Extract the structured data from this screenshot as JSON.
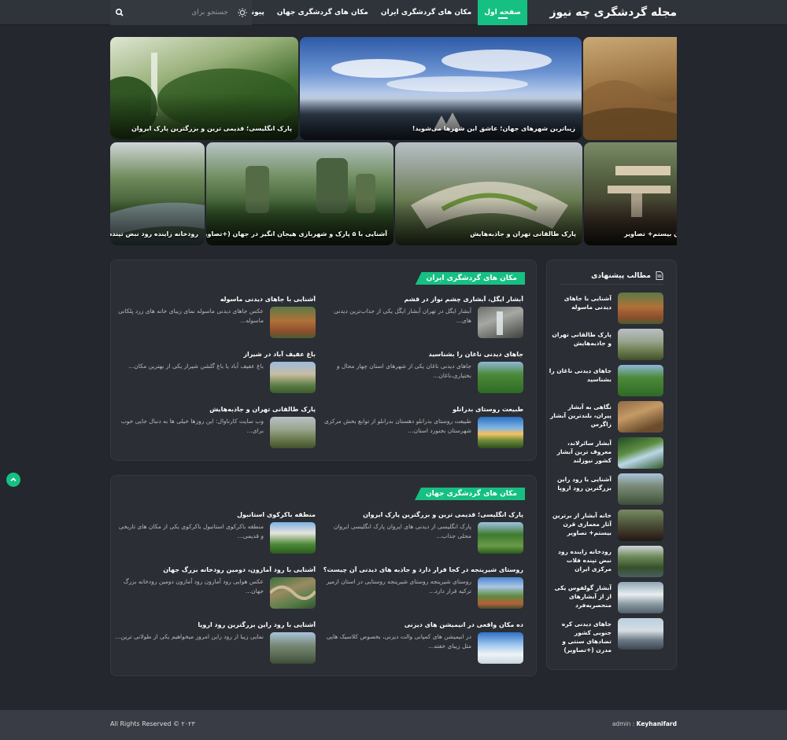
{
  "header": {
    "site_title": "مجله گردشگری چه نیوز",
    "nav": [
      {
        "label": "صفحه اول",
        "active": true
      },
      {
        "label": "مکان های گردشگری ایران"
      },
      {
        "label": "مکان های گردشگری جهان"
      },
      {
        "label": "پیوندها"
      }
    ],
    "search_placeholder": "جستجو برای",
    "search_icon": "search-icon",
    "theme_icon": "sun-icon"
  },
  "slider": {
    "slides": [
      {
        "caption": "پارک انگلیسی؛ قدیمی ترین و بزرگترین پارک ایروان"
      },
      {
        "caption": "زیباترین شهرهای جهان؛ عاشق این شهرها می‌شوید!"
      },
      {
        "caption": ""
      },
      {
        "caption": "رودخانه زاینده رود نبض تپنده فلا"
      },
      {
        "caption": "آشنایی با ۵ پارک و شهربازی هیجان انگیز در جهان (+تصاویر)"
      },
      {
        "caption": "پارک طالقانی تهران و جاذبه‌هایش"
      },
      {
        "caption": "ن بیستم+ تصاویر"
      }
    ]
  },
  "iran_section": {
    "title": "مکان های گردشگری ایران",
    "posts": [
      {
        "title": "آبشار ایگل، آبشاری چشم نواز در قشم",
        "excerpt": "آبشار ایگل در تهران   آبشار ایگَل یکی از جذاب‌ترین دیدنی های..."
      },
      {
        "title": "آشنایی با جاهای دیدنی ماسوله",
        "excerpt": "عکس جاهای دیدنی ماسوله   نمای زیبای خانه های زرد پلکانی ماسوله..."
      },
      {
        "title": "جاهای دیدنی ناغان را بشناسید",
        "excerpt": "جاهای دیدنی ناغان   یکی از شهرهای استان چهار محال و بختیاری،ناغان..."
      },
      {
        "title": "باغ عفیف آباد در شیراز",
        "excerpt": "باغ عفیف آباد یا باغ گلشن   شیراز یکی از بهترین مکان..."
      },
      {
        "title": "طبیعت روستای بدرانلو",
        "excerpt": "طبیعت روستای بدرانلو دهستان بدرانلو از توابع بخش مرکزی شهرستان بجنورد استان..."
      },
      {
        "title": "پارک طالقانی تهران و جاذبه‌هایش",
        "excerpt": "وب سایت کارناوال: این روزها خیلی ها به دنبال جایی خوب برای..."
      }
    ]
  },
  "world_section": {
    "title": "مکان های گردشگری جهان",
    "posts": [
      {
        "title": "پارک انگلیسی؛ قدیمی ترین و بزرگترین پارک ایروان",
        "excerpt": "پارک انگلیسی از دیدنی های ایروان   پارک انگلیسی ایروان محلی جذاب..."
      },
      {
        "title": "منطقه باکرکوی استانبول",
        "excerpt": "منطقه باکرکوی استانبول   باکرکوی یکی از مکان های تاریخی و قدیمی..."
      },
      {
        "title": "روستای شیرینجه در کجا قرار دارد و جاذبه های دیدنی آن چیست؟",
        "excerpt": "روستای شیرینجه   روستای شیرینجه روستایی در استان ازمیر ترکیه قرار دارد..."
      },
      {
        "title": "آشنایی با رود آمازون، دومین رودخانه بزرگ جهان",
        "excerpt": "عکس هوایی رود آمازون   رود آمازون دومین رودخانه بزرگ جهان..."
      },
      {
        "title": "ده مکان واقعی در انیمیشن های دیزنی",
        "excerpt": "در انیمیشن های کمپانی والت دیزنی، بخصوص کلاسیک هایی مثل زیبای خفته..."
      },
      {
        "title": "آشنایی با رود راین بزرگترین رود اروپا",
        "excerpt": "نمایی زیبا از رود راین   امروز میخواهیم یکی از طولانی ترین..."
      }
    ]
  },
  "sidebar": {
    "title": "مطالب پیشنهادی",
    "icon": "document-icon",
    "items": [
      {
        "title": "آشنایی با جاهای دیدنی ماسوله"
      },
      {
        "title": "پارک طالقانی تهران و جاذبه‌هایش"
      },
      {
        "title": "جاهای دیدنی ناغان را بشناسید"
      },
      {
        "title": "نگاهی به آبشار پیران، بلندترین آبشار زاگرس"
      },
      {
        "title": "آبشار سائرلاند، معروف ترین آبشار کشور نیوزلند"
      },
      {
        "title": "آشنایی با رود راین بزرگترین رود اروپا"
      },
      {
        "title": "خانه آبشار از برترین آثار معماری قرن بیستم+ تصاویر"
      },
      {
        "title": "رودخانه زاینده رود نبض تپنده فلات مرکزی ایران"
      },
      {
        "title": "آبشار گولفوس یکی از از آبشارهای منحصربه‌فرد"
      },
      {
        "title": "جاهای دیدنی کره جنوبی کشور تضادهای سنتی و مدرن (+تصاویر)"
      }
    ]
  },
  "footer": {
    "copyright": "All Rights Reserved © ۲۰۲۳",
    "author_label": "admin :",
    "author_name": "Keyhanifard"
  },
  "colors": {
    "accent": "#16c083",
    "background": "#24272d",
    "panel": "#2b2e34",
    "header": "#2f333a",
    "footer": "#393c44"
  }
}
